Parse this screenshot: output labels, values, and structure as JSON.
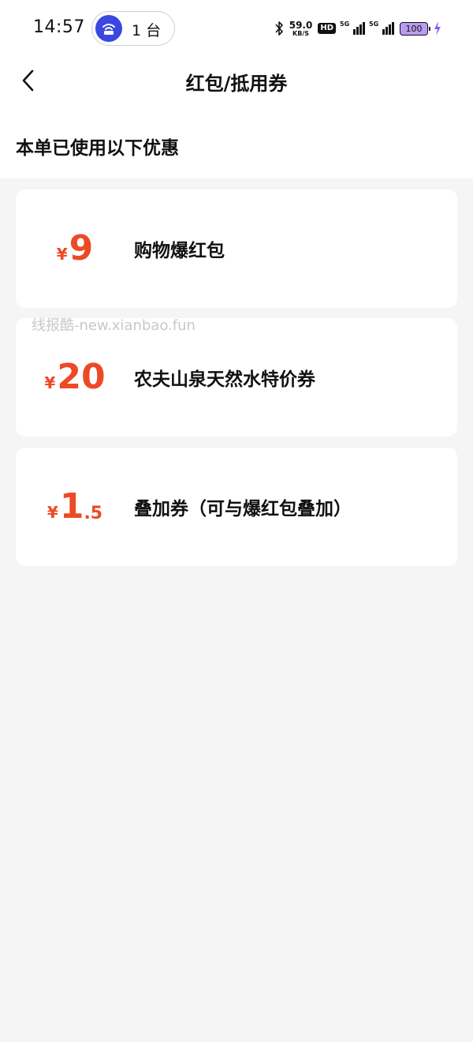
{
  "status_bar": {
    "time": "14:57",
    "hotspot_count": "1 台",
    "net_speed_value": "59.0",
    "net_speed_unit": "KB/S",
    "hd_label": "HD",
    "signal1_label": "5G",
    "signal2_label": "5G",
    "battery_level": "100",
    "accent_color": "#3b47e0",
    "battery_color": "#b99cf0"
  },
  "header": {
    "back_icon": "chevron-left-icon",
    "title": "红包/抵用券"
  },
  "section": {
    "label": "本单已使用以下优惠"
  },
  "coupons": [
    {
      "currency": "¥",
      "amount_int": "9",
      "amount_dec": "",
      "name": "购物爆红包"
    },
    {
      "currency": "¥",
      "amount_int": "20",
      "amount_dec": "",
      "name": "农夫山泉天然水特价券"
    },
    {
      "currency": "¥",
      "amount_int": "1",
      "amount_dec": ".5",
      "name": "叠加券（可与爆红包叠加）"
    }
  ],
  "watermark": "线报酷-new.xianbao.fun",
  "colors": {
    "amount": "#ec4a26",
    "background": "#f5f5f5",
    "card": "#ffffff"
  }
}
